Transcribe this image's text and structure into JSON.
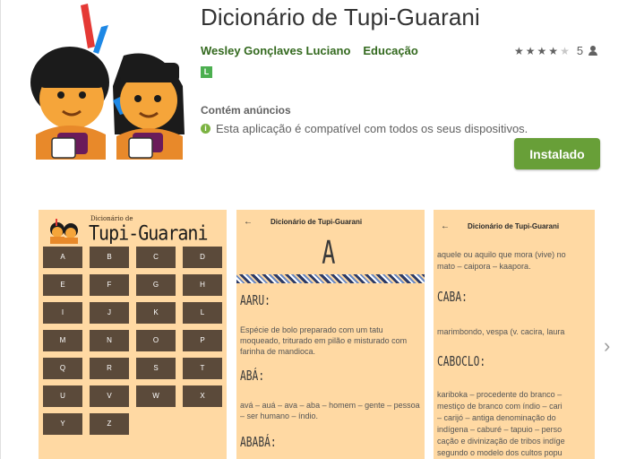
{
  "app": {
    "title": "Dicionário de Tupi-Guarani",
    "developer": "Wesley Gonçlaves Luciano",
    "category": "Educação",
    "rating_value": 4,
    "rating_count": "5",
    "content_rating": "L",
    "ads_label": "Contém anúncios",
    "compat_text": "Esta aplicação é compatível com todos os seus dispositivos.",
    "install_label": "Instalado"
  },
  "colors": {
    "accent_green": "#689f38",
    "dev_green": "#33691e",
    "screenshot_bg": "#ffd9a3"
  },
  "screenshot1": {
    "subtitle": "Dicionário de",
    "title": "Tupi-Guarani",
    "keys": [
      "A",
      "B",
      "C",
      "D",
      "E",
      "F",
      "G",
      "H",
      "I",
      "J",
      "K",
      "L",
      "M",
      "N",
      "O",
      "P",
      "Q",
      "R",
      "S",
      "T",
      "U",
      "V",
      "W",
      "X",
      "Y",
      "Z"
    ]
  },
  "screenshot2": {
    "appbar_title": "Dicionário de Tupi-Guarani",
    "letter": "A",
    "entries": [
      {
        "head": "AARU:",
        "text": "Espécie de bolo preparado com um tatu moqueado, triturado em pilão e misturado com farinha de mandioca."
      },
      {
        "head": "ABÁ:",
        "text": "avá – auá – ava – aba – homem – gente – pessoa – ser humano – índio."
      },
      {
        "head": "ABABÁ:",
        "text": ""
      }
    ]
  },
  "screenshot3": {
    "appbar_title": "Dicionário de Tupi-Guarani",
    "line1": "aquele ou aquilo que mora (vive) no",
    "line2": "mato – caipora – kaapora.",
    "head1": "CABA:",
    "line3": "marimbondo, vespa (v. cacira, laura",
    "head2": "CABOCLO:",
    "line4": "kariboka – procedente do branco –",
    "line5": "mestiço de branco com índio – cari",
    "line6": "– carijó – antiga denominação do",
    "line7": "indígena – caburé – tapuio – perso",
    "line8": "cação e divinização de tribos indíge",
    "line9": "segundo o modelo dos cultos popu"
  }
}
